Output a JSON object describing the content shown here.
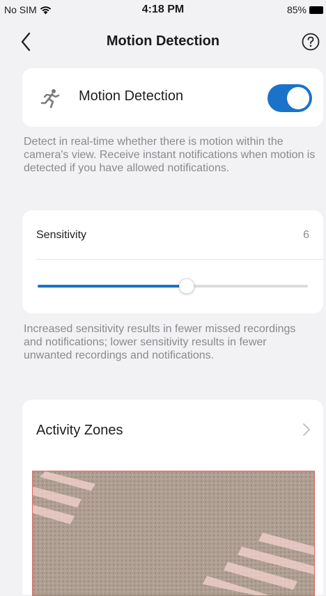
{
  "status_bar": {
    "carrier": "No SIM",
    "time": "4:18 PM",
    "battery": "85%",
    "icons": {
      "wifi": "wifi-icon",
      "battery": "battery-icon"
    }
  },
  "nav": {
    "title": "Motion Detection",
    "icons": {
      "back": "back-chevron-icon",
      "help": "help-circle-icon"
    }
  },
  "motion": {
    "label": "Motion Detection",
    "enabled": true,
    "icon": "running-person-icon",
    "description": "Detect in real-time whether there is motion within the camera's view. Receive instant notifications when motion is detected if you have allowed notifications."
  },
  "sensitivity": {
    "label": "Sensitivity",
    "value": "6",
    "slider_fraction": 0.55,
    "description": "Increased sensitivity results in fewer missed recordings and notifications; lower sensitivity results in fewer unwanted recordings and notifications."
  },
  "activity_zones": {
    "label": "Activity Zones",
    "icon": "chevron-right-icon"
  },
  "colors": {
    "accent": "#1a73c8",
    "background": "#f2f2f4",
    "secondary_text": "#8a8a8e",
    "zone_border": "#e0665c",
    "zone_fill": "#f4d4d0"
  }
}
